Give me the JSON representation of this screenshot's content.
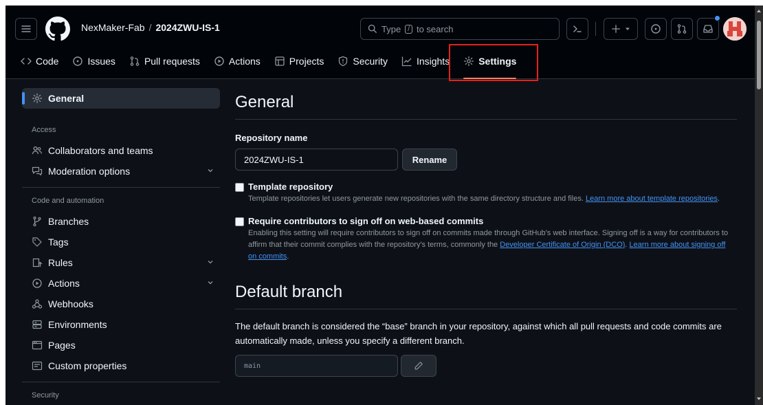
{
  "header": {
    "owner": "NexMaker-Fab",
    "separator": "/",
    "repo": "2024ZWU-IS-1",
    "search": {
      "prefix": "Type",
      "key": "/",
      "suffix": "to search"
    }
  },
  "tabs": [
    {
      "label": "Code",
      "icon": "code-icon"
    },
    {
      "label": "Issues",
      "icon": "issue-opened-icon"
    },
    {
      "label": "Pull requests",
      "icon": "git-pull-request-icon"
    },
    {
      "label": "Actions",
      "icon": "play-icon"
    },
    {
      "label": "Projects",
      "icon": "table-icon"
    },
    {
      "label": "Security",
      "icon": "shield-icon"
    },
    {
      "label": "Insights",
      "icon": "graph-icon"
    },
    {
      "label": "Settings",
      "icon": "gear-icon",
      "active": true
    }
  ],
  "sidebar": {
    "general": "General",
    "access_heading": "Access",
    "access": [
      {
        "label": "Collaborators and teams",
        "icon": "people-icon"
      },
      {
        "label": "Moderation options",
        "icon": "comment-discussion-icon"
      }
    ],
    "code_heading": "Code and automation",
    "code": [
      {
        "label": "Branches",
        "icon": "git-branch-icon"
      },
      {
        "label": "Tags",
        "icon": "tag-icon"
      },
      {
        "label": "Rules",
        "icon": "repo-push-icon"
      },
      {
        "label": "Actions",
        "icon": "play-icon"
      },
      {
        "label": "Webhooks",
        "icon": "webhook-icon"
      },
      {
        "label": "Environments",
        "icon": "server-icon"
      },
      {
        "label": "Pages",
        "icon": "browser-icon"
      },
      {
        "label": "Custom properties",
        "icon": "note-icon"
      }
    ],
    "security_heading": "Security"
  },
  "main": {
    "general_title": "General",
    "repo_name_label": "Repository name",
    "repo_name_value": "2024ZWU-IS-1",
    "rename_button": "Rename",
    "template": {
      "title": "Template repository",
      "desc": "Template repositories let users generate new repositories with the same directory structure and files.",
      "link": "Learn more about template repositories",
      "checked": false
    },
    "signoff": {
      "title": "Require contributors to sign off on web-based commits",
      "desc1": "Enabling this setting will require contributors to sign off on commits made through GitHub's web interface. Signing off is a way for contributors to affirm that their commit complies with the repository's terms, commonly the",
      "link1": "Developer Certificate of Origin (DCO)",
      "link2": "Learn more about signing off on commits",
      "checked": false
    },
    "default_branch_title": "Default branch",
    "default_branch_text": "The default branch is considered the “base” branch in your repository, against which all pull requests and code commits are automatically made, unless you specify a different branch.",
    "default_branch_value": "main"
  },
  "colors": {
    "background": "#0d1117",
    "header": "#010409",
    "link": "#4493f8",
    "active_tab_underline": "#f78166",
    "highlight_box": "#e8201a"
  }
}
